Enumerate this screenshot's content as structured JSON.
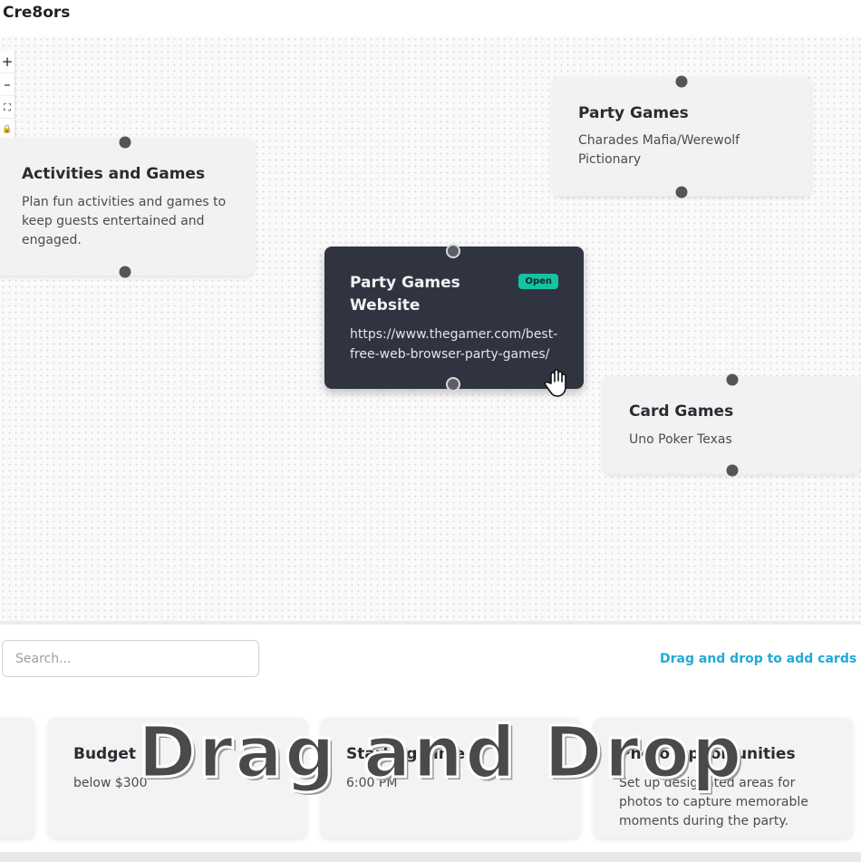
{
  "app": {
    "title": "Cre8ors"
  },
  "controls": {
    "zoom_in": "+",
    "zoom_out": "–",
    "fit": "⛶",
    "lock": "🔒"
  },
  "nodes": [
    {
      "title": "Activities and Games",
      "body": "Plan fun activities and games to keep guests entertained and engaged."
    },
    {
      "title": "Party Games",
      "body": "Charades Mafia/Werewolf Pictionary"
    },
    {
      "title": "Party Games Website",
      "body": "https://www.thegamer.com/best-free-web-browser-party-games/",
      "badge": "Open"
    },
    {
      "title": "Card Games",
      "body": "Uno Poker Texas"
    }
  ],
  "search": {
    "placeholder": "Search..."
  },
  "hint": "Drag and drop to add cards to",
  "tray": [
    {
      "title": "Budget",
      "body": "below $300"
    },
    {
      "title": "Starting Time",
      "body": "6:00 PM"
    },
    {
      "title": "Photo Opportunities",
      "body": "Set up designated areas for photos to capture memorable moments during the party."
    }
  ],
  "overlay_caption": "Drag and Drop"
}
